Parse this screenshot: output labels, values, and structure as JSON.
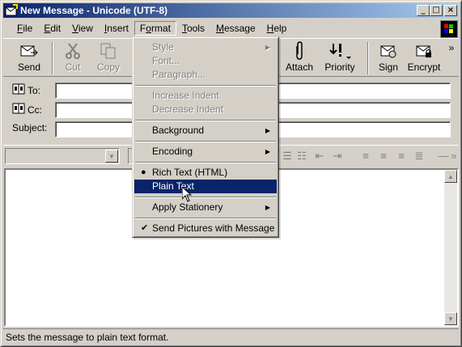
{
  "window": {
    "title": "New Message - Unicode (UTF-8)",
    "controls": {
      "minimize": "_",
      "maximize": "□",
      "close": "×"
    }
  },
  "menubar": {
    "items": [
      "File",
      "Edit",
      "View",
      "Insert",
      "Format",
      "Tools",
      "Message",
      "Help"
    ],
    "open_item": "Format"
  },
  "toolbar": {
    "send": "Send",
    "cut": "Cut",
    "copy": "Copy",
    "attach": "Attach",
    "priority": "Priority",
    "sign": "Sign",
    "encrypt": "Encrypt",
    "more": "»"
  },
  "fields": {
    "to_label": "To:",
    "cc_label": "Cc:",
    "subject_label": "Subject:",
    "to_value": "",
    "cc_value": "",
    "subject_value": ""
  },
  "format_menu": {
    "style": "Style",
    "font": "Font...",
    "paragraph": "Paragraph...",
    "increase_indent": "Increase Indent",
    "decrease_indent": "Decrease Indent",
    "background": "Background",
    "encoding": "Encoding",
    "rich_text": "Rich Text (HTML)",
    "plain_text": "Plain Text",
    "apply_stationery": "Apply Stationery",
    "send_pictures": "Send Pictures with Message",
    "selected_mode": "Rich Text (HTML)",
    "highlighted": "Plain Text"
  },
  "statusbar": {
    "text": "Sets the message to plain text format."
  },
  "colors": {
    "title_start": "#0a246a",
    "title_end": "#a6caf0",
    "highlight": "#0a246a",
    "face": "#d4d0c8"
  }
}
